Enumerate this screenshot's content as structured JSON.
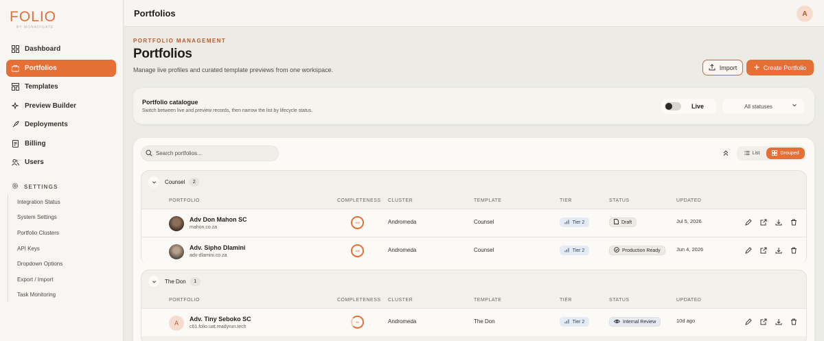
{
  "brand": {
    "logo": "FOLIO",
    "tagline": "BY MONADIGATE"
  },
  "sidebar": {
    "items": [
      {
        "label": "Dashboard",
        "icon": "grid-icon"
      },
      {
        "label": "Portfolios",
        "icon": "briefcase-icon",
        "active": true
      },
      {
        "label": "Templates",
        "icon": "template-icon"
      },
      {
        "label": "Preview Builder",
        "icon": "sparkle-icon"
      },
      {
        "label": "Deployments",
        "icon": "rocket-icon"
      },
      {
        "label": "Billing",
        "icon": "receipt-icon"
      },
      {
        "label": "Users",
        "icon": "users-icon"
      }
    ],
    "settings_label": "SETTINGS",
    "settings_items": [
      "Integration Status",
      "System Settings",
      "Portfolio Clusters",
      "API Keys",
      "Dropdown Options",
      "Export / Import",
      "Task Monitoring"
    ]
  },
  "topbar": {
    "title": "Portfolios",
    "avatar": "A"
  },
  "header": {
    "eyebrow": "PORTFOLIO MANAGEMENT",
    "title": "Portfolios",
    "subtitle": "Manage live profiles and curated template previews from one workspace.",
    "import_label": "Import",
    "create_label": "Create Portfolio"
  },
  "catalogue": {
    "title": "Portfolio catalogue",
    "subtitle": "Switch between live and preview records, then narrow the list by lifecycle status.",
    "live_label": "Live",
    "status_filter": "All statuses"
  },
  "list": {
    "search_placeholder": "Search portfolios...",
    "view_list": "List",
    "view_grouped": "Grouped",
    "columns": [
      "PORTFOLIO",
      "COMPLETENESS",
      "CLUSTER",
      "TEMPLATE",
      "TIER",
      "STATUS",
      "UPDATED"
    ],
    "groups": [
      {
        "name": "Counsel",
        "count": "2",
        "rows": [
          {
            "name": "Adv Don Mahon SC",
            "url": "mahon.co.za",
            "completeness": "100",
            "cluster": "Andromeda",
            "template": "Counsel",
            "tier": "Tier 2",
            "status": "Draft",
            "updated": "Jul 5, 2026"
          },
          {
            "name": "Adv. Sipho Dlamini",
            "url": "adv-dlamini.co.za",
            "completeness": "100",
            "cluster": "Andromeda",
            "template": "Counsel",
            "tier": "Tier 2",
            "status": "Production Ready",
            "updated": "Jun 4, 2026"
          }
        ]
      },
      {
        "name": "The Don",
        "count": "1",
        "rows": [
          {
            "initial": "A",
            "name": "Adv. Tiny Seboko SC",
            "url": "c61.folio.uat.readyrun.tech",
            "completeness": "92",
            "cluster": "Andromeda",
            "template": "The Don",
            "tier": "Tier 2",
            "status": "Internal Review",
            "updated": "10d ago"
          }
        ]
      }
    ]
  },
  "colors": {
    "accent": "#e66f35",
    "background": "#ecebe6",
    "tier_badge": "#e4ebf4"
  }
}
